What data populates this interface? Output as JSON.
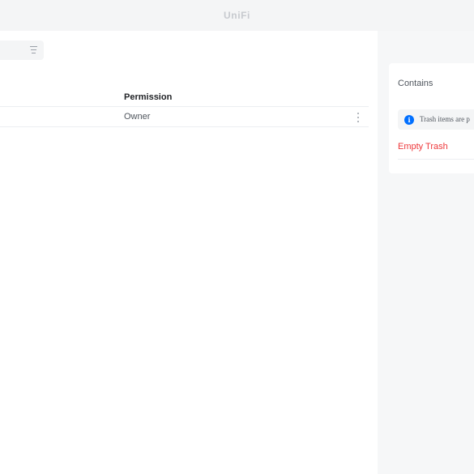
{
  "header": {
    "brand": "UniFi"
  },
  "table": {
    "columns": [
      "Permission"
    ],
    "rows": [
      {
        "permission": "Owner"
      }
    ]
  },
  "side_panel": {
    "contains_label": "Contains",
    "info_text": "Trash items are p",
    "empty_trash_label": "Empty Trash"
  },
  "colors": {
    "accent": "#006fff",
    "danger": "#ee383b"
  }
}
